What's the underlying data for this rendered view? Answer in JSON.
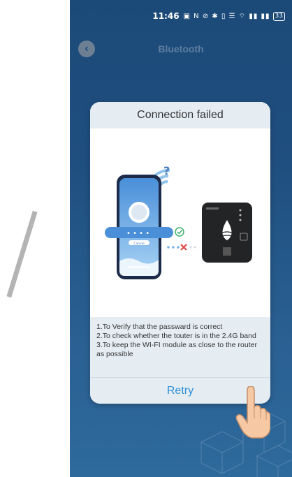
{
  "status_bar": {
    "time": "11:46",
    "icons": "▣ N ⊘ ✱ ▯ ☰ ⌔ ▮▮ ▮▮",
    "battery": "33"
  },
  "screen": {
    "title": "Bluetooth"
  },
  "dialog": {
    "title": "Connection failed",
    "notes": [
      "1.To Verify that the passward is correct",
      "2.To check whether the touter is in the 2.4G band",
      "3.To keep the WI-FI module as close to the router as possible"
    ],
    "retry_label": "Retry",
    "phone_password_mask": "• • • •",
    "phone_button_label": "Cancel"
  },
  "colors": {
    "accent": "#2e8fd6",
    "background": "#1f4f80",
    "dialog_gray": "#e5edf3"
  }
}
